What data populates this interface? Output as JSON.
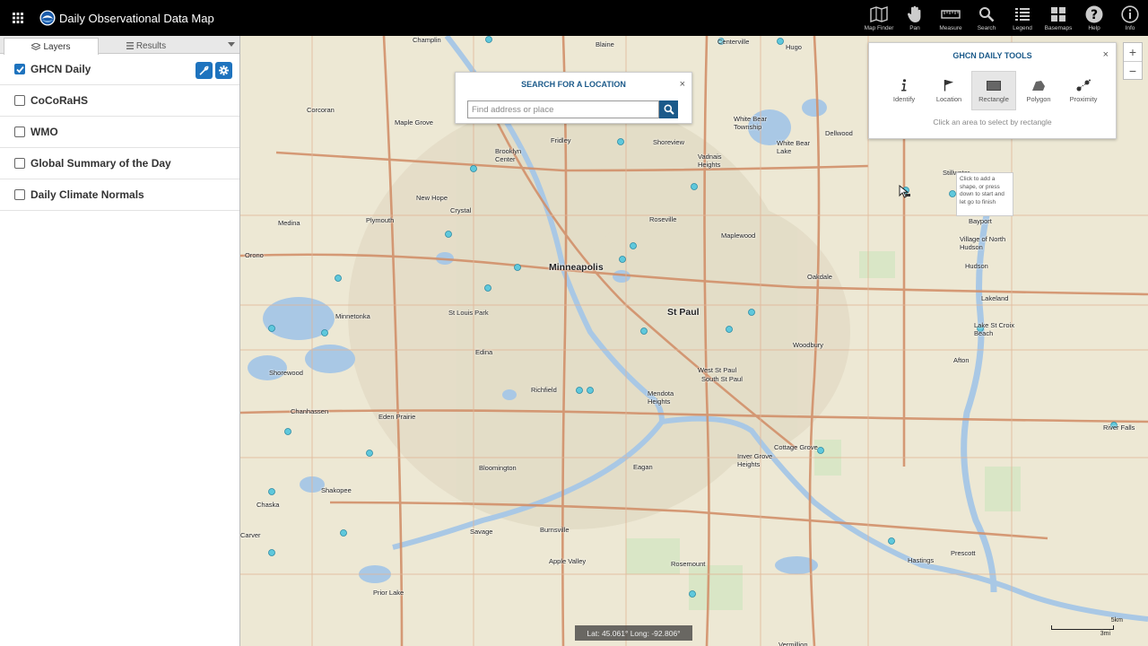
{
  "header": {
    "title": "Daily Observational Data Map",
    "tools": [
      {
        "name": "map-finder",
        "label": "Map Finder",
        "icon": "map-finder-icon"
      },
      {
        "name": "pan",
        "label": "Pan",
        "icon": "hand-icon"
      },
      {
        "name": "measure",
        "label": "Measure",
        "icon": "ruler-icon"
      },
      {
        "name": "search",
        "label": "Search",
        "icon": "search-icon"
      },
      {
        "name": "legend",
        "label": "Legend",
        "icon": "list-icon"
      },
      {
        "name": "basemaps",
        "label": "Basemaps",
        "icon": "basemaps-icon"
      },
      {
        "name": "help",
        "label": "Help",
        "icon": "help-icon"
      },
      {
        "name": "info",
        "label": "Info",
        "icon": "info-icon"
      }
    ]
  },
  "panel": {
    "tabs": [
      {
        "label": "Layers",
        "active": true
      },
      {
        "label": "Results",
        "active": false
      }
    ],
    "layers": [
      {
        "label": "GHCN Daily",
        "checked": true
      },
      {
        "label": "CoCoRaHS",
        "checked": false
      },
      {
        "label": "WMO",
        "checked": false
      },
      {
        "label": "Global Summary of the Day",
        "checked": false
      },
      {
        "label": "Daily Climate Normals",
        "checked": false
      }
    ]
  },
  "search": {
    "title": "SEARCH FOR A LOCATION",
    "placeholder": "Find address or place",
    "close": "×"
  },
  "ghcn_tools": {
    "title": "GHCN DAILY TOOLS",
    "close": "×",
    "tools": [
      {
        "label": "Identify",
        "icon": "info-i-icon",
        "active": false
      },
      {
        "label": "Location",
        "icon": "flag-icon",
        "active": false
      },
      {
        "label": "Rectangle",
        "icon": "rectangle-icon",
        "active": true
      },
      {
        "label": "Polygon",
        "icon": "polygon-icon",
        "active": false
      },
      {
        "label": "Proximity",
        "icon": "proximity-icon",
        "active": false
      }
    ],
    "hint": "Click an area to select by rectangle"
  },
  "zoom": {
    "in": "+",
    "out": "−"
  },
  "tooltip": {
    "text": "Click to add a shape, or press down to start and let go to finish"
  },
  "coords": {
    "text": "Lat: 45.061°  Long: -92.806°"
  },
  "scale": {
    "km": "5km",
    "mi": "3mi"
  },
  "colors": {
    "topbar": "#000000",
    "accent": "#1e73be",
    "panel_title": "#1b5a8a",
    "station": "#5fc8dc",
    "water": "#a9c8e5",
    "road": "#d2906a",
    "land": "#ede8d4"
  },
  "map": {
    "places": [
      {
        "name": "Champlin",
        "major": false
      },
      {
        "name": "Blaine",
        "major": false
      },
      {
        "name": "Centerville",
        "major": false
      },
      {
        "name": "Hugo",
        "major": false
      },
      {
        "name": "Corcoran",
        "major": false
      },
      {
        "name": "Maple Grove",
        "major": false
      },
      {
        "name": "Brooklyn Center",
        "major": false
      },
      {
        "name": "Fridley",
        "major": false
      },
      {
        "name": "Shoreview",
        "major": false
      },
      {
        "name": "White Bear Township",
        "major": false
      },
      {
        "name": "White Bear Lake",
        "major": false
      },
      {
        "name": "Dellwood",
        "major": false
      },
      {
        "name": "Vadnais Heights",
        "major": false
      },
      {
        "name": "New Hope",
        "major": false
      },
      {
        "name": "Crystal",
        "major": false
      },
      {
        "name": "Medina",
        "major": false
      },
      {
        "name": "Plymouth",
        "major": false
      },
      {
        "name": "Roseville",
        "major": false
      },
      {
        "name": "Maplewood",
        "major": false
      },
      {
        "name": "Orono",
        "major": false
      },
      {
        "name": "Minneapolis",
        "major": true
      },
      {
        "name": "St Paul",
        "major": true
      },
      {
        "name": "Oakdale",
        "major": false
      },
      {
        "name": "Minnetonka",
        "major": false
      },
      {
        "name": "St Louis Park",
        "major": false
      },
      {
        "name": "Edina",
        "major": false
      },
      {
        "name": "Woodbury",
        "major": false
      },
      {
        "name": "Shorewood",
        "major": false
      },
      {
        "name": "Richfield",
        "major": false
      },
      {
        "name": "Mendota Heights",
        "major": false
      },
      {
        "name": "West St Paul",
        "major": false
      },
      {
        "name": "South St Paul",
        "major": false
      },
      {
        "name": "Chanhassen",
        "major": false
      },
      {
        "name": "Eden Prairie",
        "major": false
      },
      {
        "name": "Bloomington",
        "major": false
      },
      {
        "name": "Eagan",
        "major": false
      },
      {
        "name": "Inver Grove Heights",
        "major": false
      },
      {
        "name": "Cottage Grove",
        "major": false
      },
      {
        "name": "Shakopee",
        "major": false
      },
      {
        "name": "Chaska",
        "major": false
      },
      {
        "name": "Savage",
        "major": false
      },
      {
        "name": "Burnsville",
        "major": false
      },
      {
        "name": "Apple Valley",
        "major": false
      },
      {
        "name": "Rosemount",
        "major": false
      },
      {
        "name": "Prior Lake",
        "major": false
      },
      {
        "name": "Hastings",
        "major": false
      },
      {
        "name": "Prescott",
        "major": false
      },
      {
        "name": "Bayport",
        "major": false
      },
      {
        "name": "Village of North Hudson",
        "major": false
      },
      {
        "name": "Hudson",
        "major": false
      },
      {
        "name": "Lakeland",
        "major": false
      },
      {
        "name": "Lake St Croix Beach",
        "major": false
      },
      {
        "name": "Afton",
        "major": false
      },
      {
        "name": "River Falls",
        "major": false
      },
      {
        "name": "Stillwater",
        "major": false
      },
      {
        "name": "Carver",
        "major": false
      },
      {
        "name": "Vermillion",
        "major": false
      }
    ]
  }
}
